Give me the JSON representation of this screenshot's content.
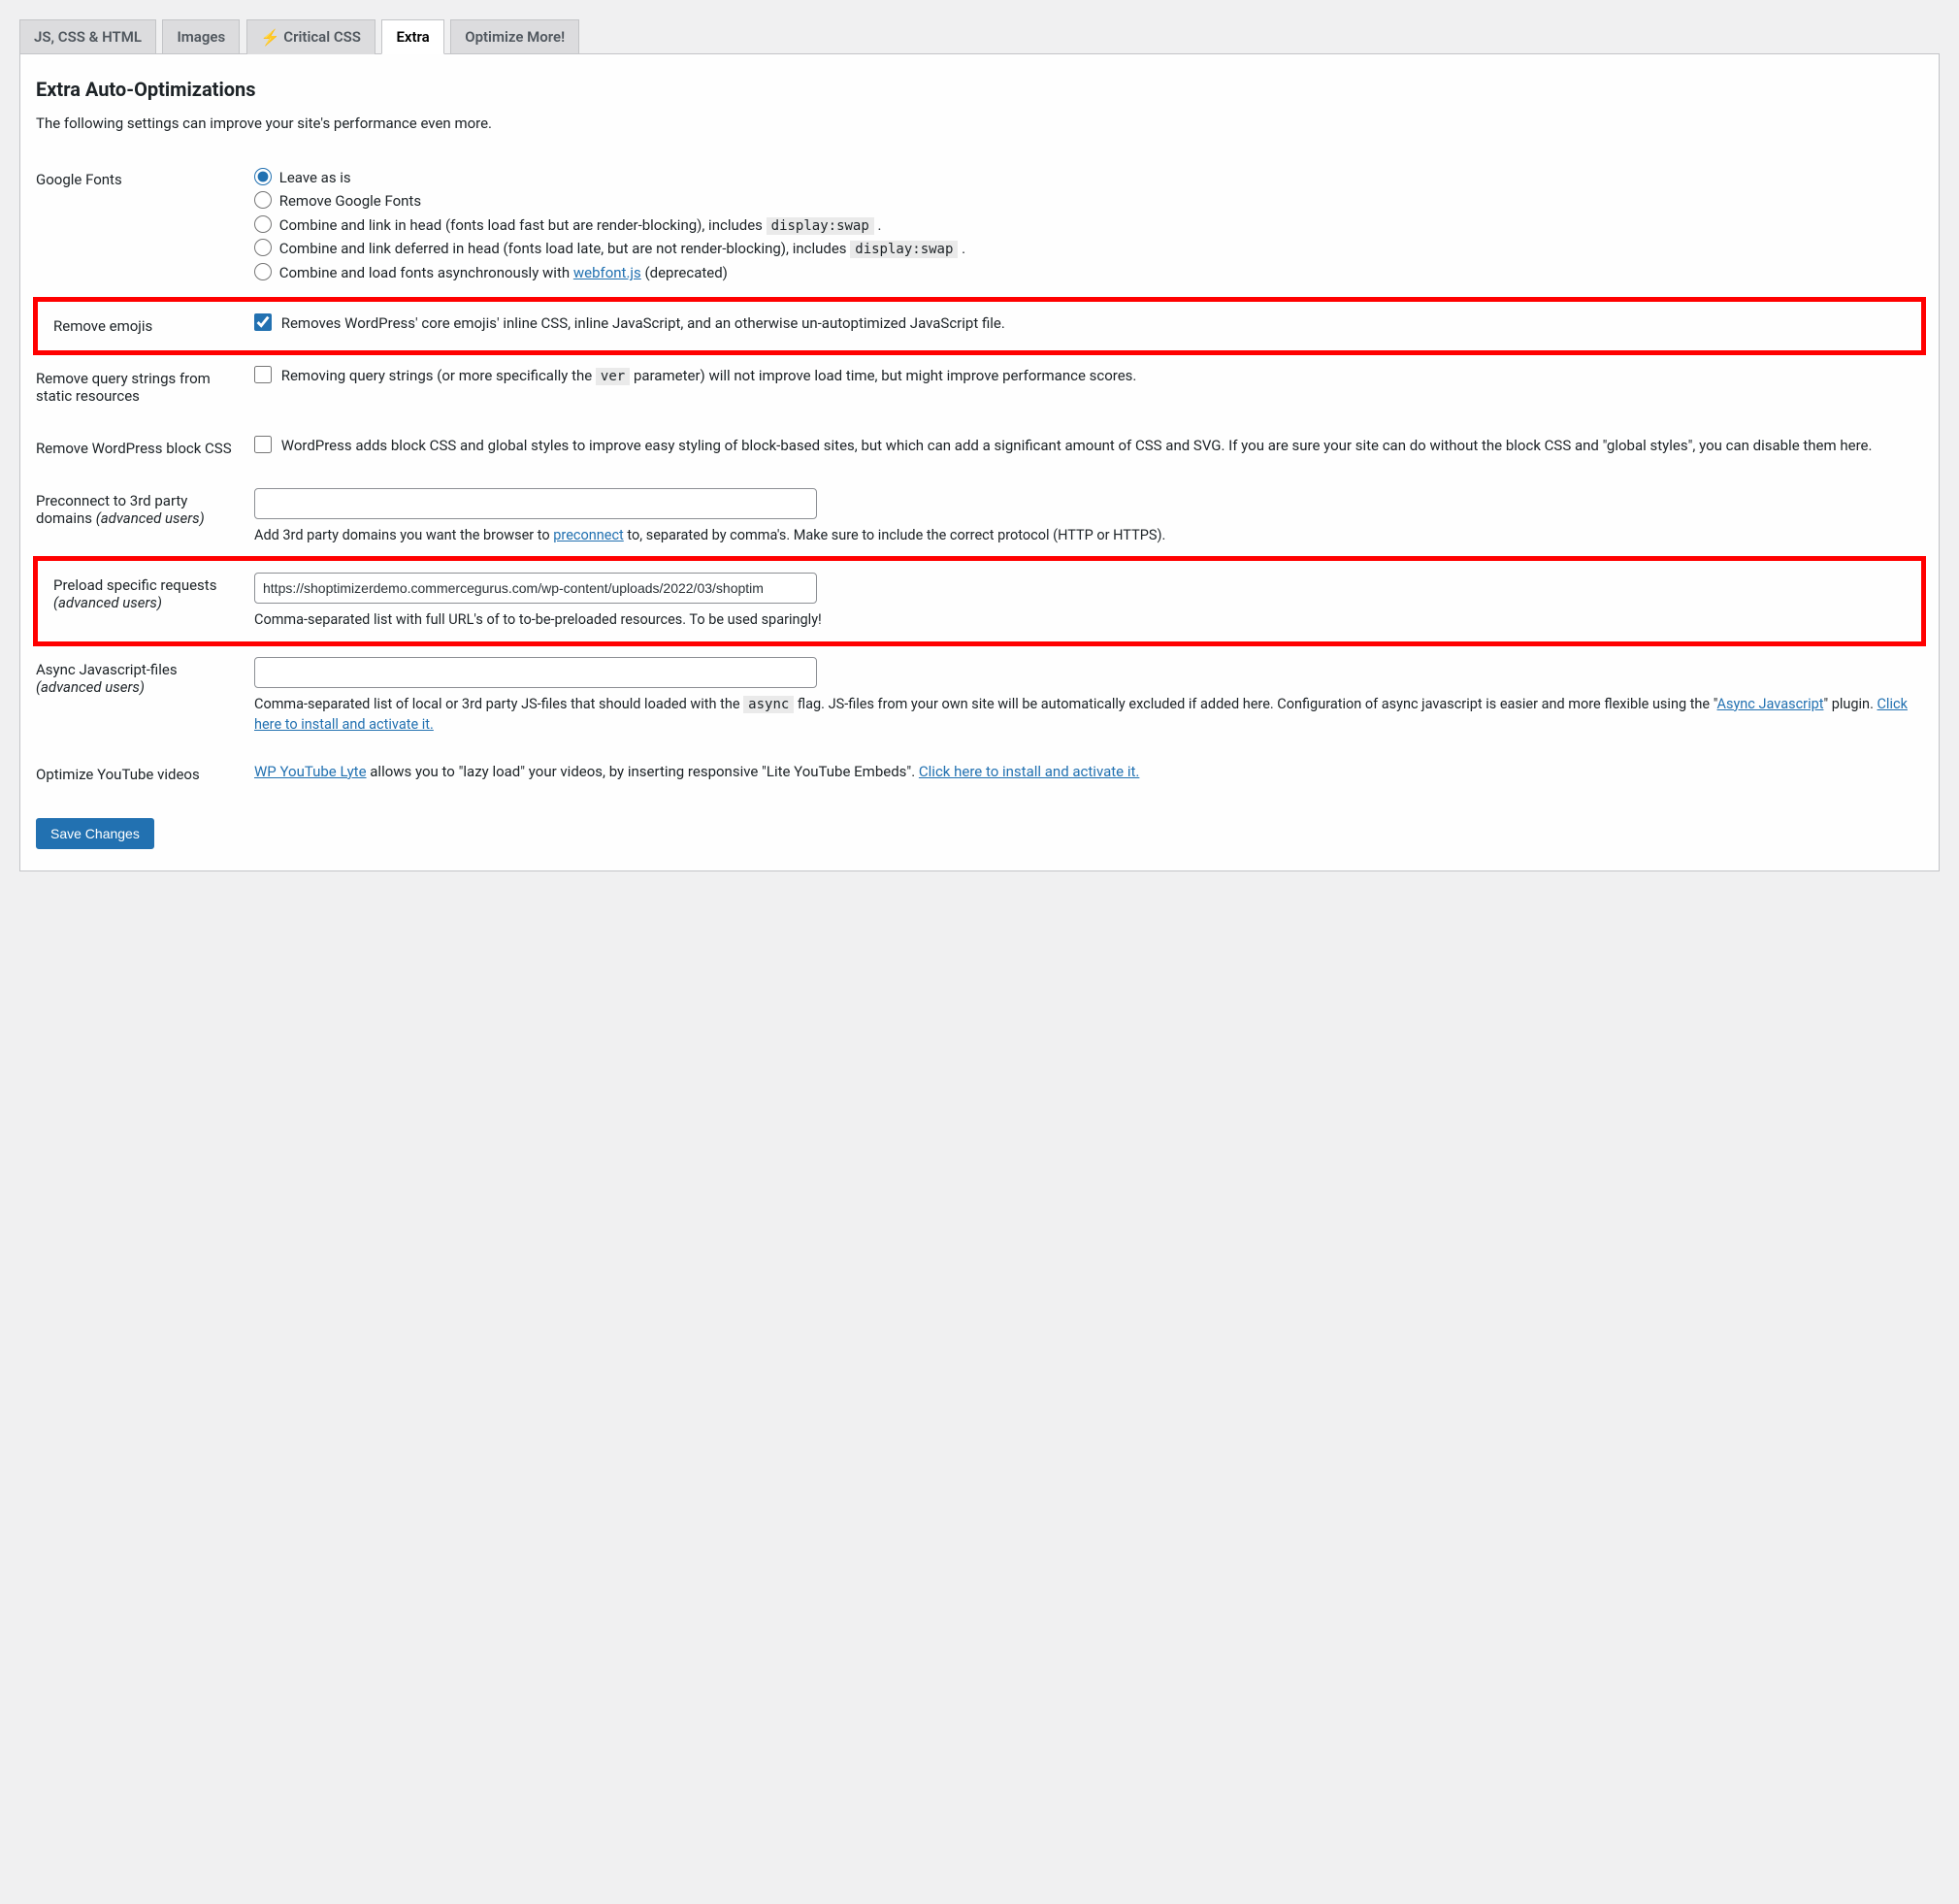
{
  "tabs": {
    "jscsshtml": "JS, CSS & HTML",
    "images": "Images",
    "criticalcss": "Critical CSS",
    "extra": "Extra",
    "optimizemore": "Optimize More!"
  },
  "section": {
    "title": "Extra Auto-Optimizations",
    "desc": "The following settings can improve your site's performance even more."
  },
  "google_fonts": {
    "label": "Google Fonts",
    "options": {
      "leave": "Leave as is",
      "remove": "Remove Google Fonts",
      "combine_head_pre": "Combine and link in head (fonts load fast but are render-blocking), includes ",
      "combine_head_code": "display:swap",
      "combine_deferred_pre": "Combine and link deferred in head (fonts load late, but are not render-blocking), includes ",
      "combine_deferred_code": "display:swap",
      "async_pre": "Combine and load fonts asynchronously with ",
      "async_link": "webfont.js",
      "async_post": " (deprecated)"
    }
  },
  "remove_emojis": {
    "label": "Remove emojis",
    "desc": "Removes WordPress' core emojis' inline CSS, inline JavaScript, and an otherwise un-autoptimized JavaScript file."
  },
  "remove_query": {
    "label": "Remove query strings from static resources",
    "desc_pre": "Removing query strings (or more specifically the ",
    "desc_code": "ver",
    "desc_post": " parameter) will not improve load time, but might improve performance scores."
  },
  "remove_block_css": {
    "label": "Remove WordPress block CSS",
    "desc": "WordPress adds block CSS and global styles to improve easy styling of block-based sites, but which can add a significant amount of CSS and SVG. If you are sure your site can do without the block CSS and \"global styles\", you can disable them here."
  },
  "preconnect": {
    "label_main": "Preconnect to 3rd party domains",
    "label_note": "(advanced users)",
    "value": "",
    "help_pre": "Add 3rd party domains you want the browser to ",
    "help_link": "preconnect",
    "help_post": " to, separated by comma's. Make sure to include the correct protocol (HTTP or HTTPS)."
  },
  "preload": {
    "label_main": "Preload specific requests",
    "label_note": "(advanced users)",
    "value": "https://shoptimizerdemo.commercegurus.com/wp-content/uploads/2022/03/shoptim",
    "help": "Comma-separated list with full URL's of to to-be-preloaded resources. To be used sparingly!"
  },
  "async_js": {
    "label_main": "Async Javascript-files",
    "label_note": "(advanced users)",
    "value": "",
    "help_pre": "Comma-separated list of local or 3rd party JS-files that should loaded with the ",
    "help_code": "async",
    "help_mid": " flag. JS-files from your own site will be automatically excluded if added here. Configuration of async javascript is easier and more flexible using the \"",
    "help_link1": "Async Javascript",
    "help_mid2": "\" plugin. ",
    "help_link2": "Click here to install and activate it."
  },
  "youtube": {
    "label": "Optimize YouTube videos",
    "link1": "WP YouTube Lyte",
    "text": " allows you to \"lazy load\" your videos, by inserting responsive \"Lite YouTube Embeds\". ",
    "link2": "Click here to install and activate it."
  },
  "save_button": "Save Changes"
}
